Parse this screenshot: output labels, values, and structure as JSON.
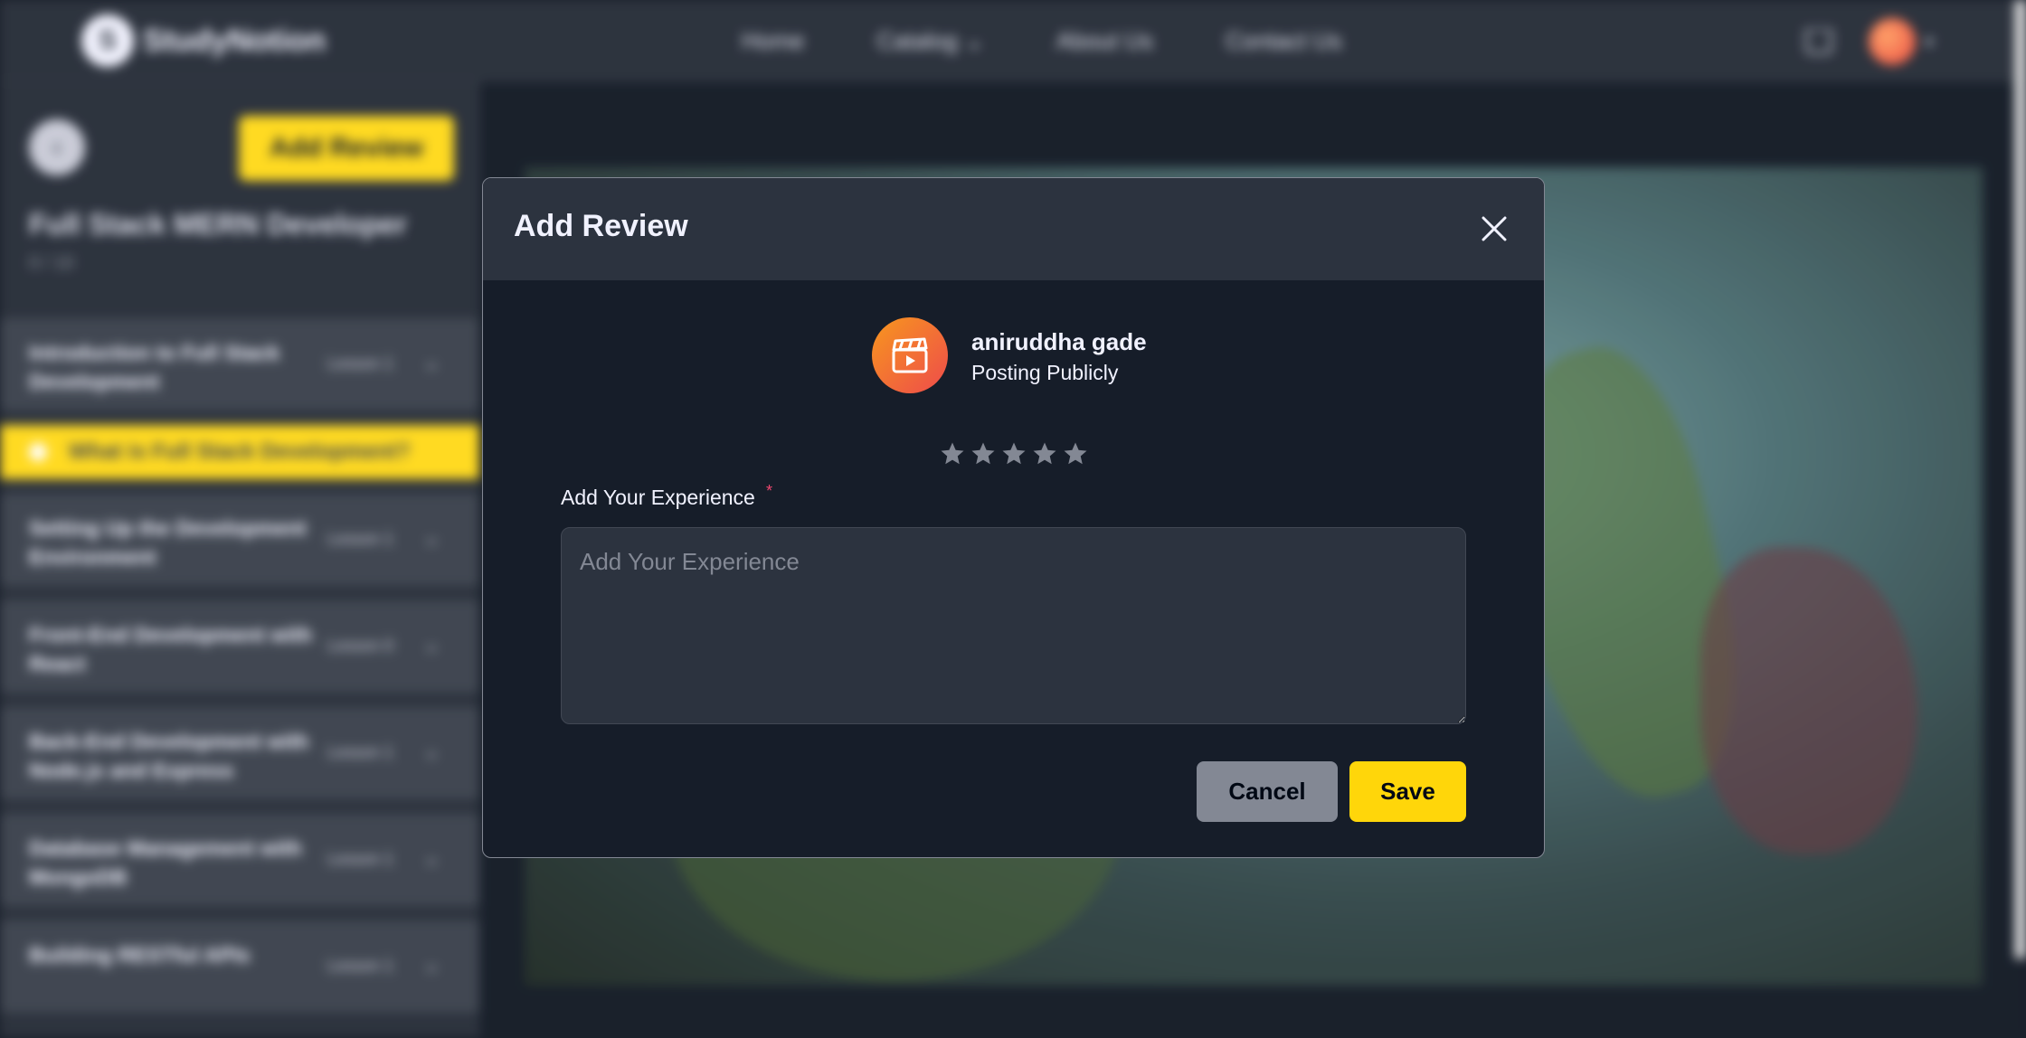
{
  "navbar": {
    "brand": "StudyNotion",
    "links": [
      "Home",
      "Catalog",
      "About Us",
      "Contact Us"
    ],
    "catalog_caret": "⌄",
    "avatar_caret": "▾"
  },
  "sidebar": {
    "back_icon": "‹",
    "add_review_label": "Add Review",
    "course_title": "Full Stack MERN Developer",
    "progress": "0 / 10",
    "sections": [
      {
        "title": "Introduction to Full Stack Development",
        "lessons": "Lesson 1",
        "chevron": "⌄"
      },
      {
        "title": "Setting Up the Development Environment",
        "lessons": "Lesson 1",
        "chevron": "⌄"
      },
      {
        "title": "Front-End Development with React",
        "lessons": "Lesson 0",
        "chevron": "⌄"
      },
      {
        "title": "Back-End Development with Node.js and Express",
        "lessons": "Lesson 1",
        "chevron": "⌄"
      },
      {
        "title": "Database Management with MongoDB",
        "lessons": "Lesson 1",
        "chevron": "⌄"
      },
      {
        "title": "Building RESTful APIs",
        "lessons": "Lesson 1",
        "chevron": "⌄"
      }
    ],
    "active_lesson": "What is Full Stack Development?"
  },
  "modal": {
    "title": "Add Review",
    "user": {
      "name": "aniruddha gade",
      "subtitle": "Posting Publicly"
    },
    "rating": {
      "max": 5,
      "value": 0,
      "empty_color": "#838894"
    },
    "experience": {
      "label": "Add Your Experience",
      "required_mark": "*",
      "placeholder": "Add Your Experience",
      "value": ""
    },
    "cancel_label": "Cancel",
    "save_label": "Save"
  },
  "colors": {
    "accent": "#ffd60a",
    "modal_bg": "#161d29",
    "header_bg": "#2c333f",
    "cancel_bg": "#838894"
  }
}
